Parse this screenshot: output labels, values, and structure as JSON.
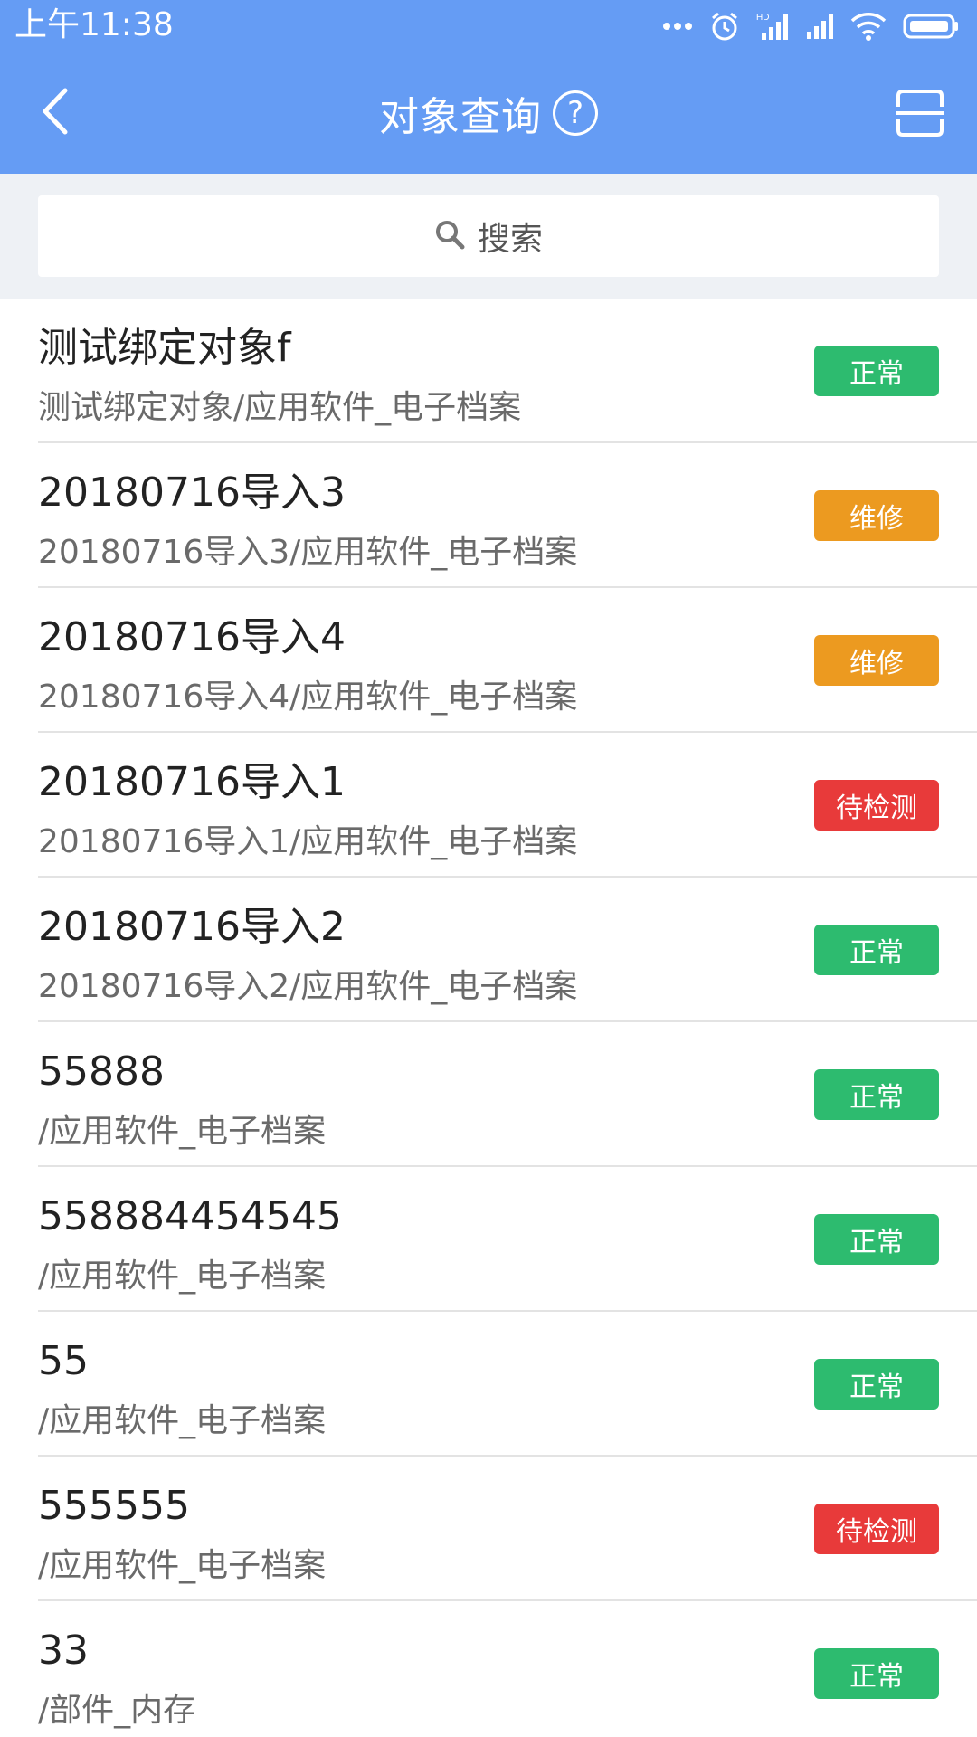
{
  "status_bar": {
    "time": "上午11:38",
    "icons": [
      "more-dots-icon",
      "alarm-icon",
      "hd-signal-icon",
      "signal-icon",
      "wifi-icon",
      "battery-icon"
    ]
  },
  "nav": {
    "title": "对象查询",
    "help_glyph": "?",
    "back_icon": "chevron-left-icon",
    "scan_icon": "scan-icon"
  },
  "search": {
    "placeholder": "搜索",
    "icon": "search-icon"
  },
  "colors": {
    "primary": "#659cf4",
    "status_normal": "#2dbb6f",
    "status_repair": "#ec9a20",
    "status_pending": "#e83a3a"
  },
  "items": [
    {
      "name": "测试绑定对象f",
      "path": "测试绑定对象/应用软件_电子档案",
      "status": "正常",
      "status_color": "#2dbb6f"
    },
    {
      "name": "20180716导入3",
      "path": "20180716导入3/应用软件_电子档案",
      "status": "维修",
      "status_color": "#ec9a20"
    },
    {
      "name": "20180716导入4",
      "path": "20180716导入4/应用软件_电子档案",
      "status": "维修",
      "status_color": "#ec9a20"
    },
    {
      "name": "20180716导入1",
      "path": "20180716导入1/应用软件_电子档案",
      "status": "待检测",
      "status_color": "#e83a3a"
    },
    {
      "name": "20180716导入2",
      "path": "20180716导入2/应用软件_电子档案",
      "status": "正常",
      "status_color": "#2dbb6f"
    },
    {
      "name": "55888",
      "path": "/应用软件_电子档案",
      "status": "正常",
      "status_color": "#2dbb6f"
    },
    {
      "name": "558884454545",
      "path": "/应用软件_电子档案",
      "status": "正常",
      "status_color": "#2dbb6f"
    },
    {
      "name": "55",
      "path": "/应用软件_电子档案",
      "status": "正常",
      "status_color": "#2dbb6f"
    },
    {
      "name": "555555",
      "path": "/应用软件_电子档案",
      "status": "待检测",
      "status_color": "#e83a3a"
    },
    {
      "name": "33",
      "path": "/部件_内存",
      "status": "正常",
      "status_color": "#2dbb6f"
    }
  ]
}
